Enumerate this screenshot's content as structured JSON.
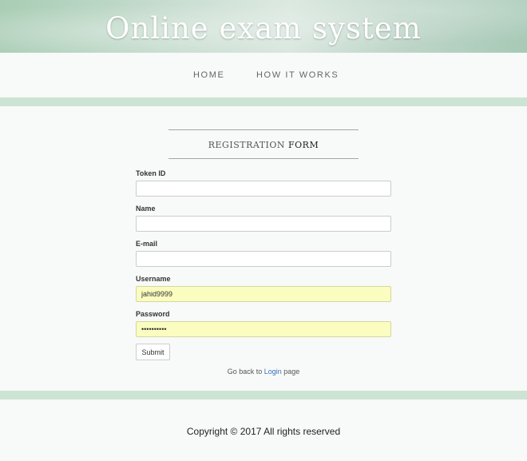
{
  "header": {
    "title": "Online exam system"
  },
  "nav": {
    "items": [
      {
        "label": "HOME"
      },
      {
        "label": "HOW IT WORKS"
      }
    ]
  },
  "form": {
    "heading_light": "REGISTRATION",
    "heading_strong": "FORM",
    "fields": [
      {
        "label": "Token ID",
        "value": ""
      },
      {
        "label": "Name",
        "value": ""
      },
      {
        "label": "E-mail",
        "value": ""
      },
      {
        "label": "Username",
        "value": "jahid9999"
      },
      {
        "label": "Password",
        "value": "••••••••••"
      }
    ],
    "submit_label": "Submit",
    "back_prefix": "Go back to",
    "back_link": "Login",
    "back_suffix": "page"
  },
  "footer": {
    "copyright": "Copyright © 2017 All rights reserved"
  },
  "colors": {
    "stripe": "#cde3d3",
    "autofill": "#fafdbf",
    "link": "#3a6fb5"
  }
}
